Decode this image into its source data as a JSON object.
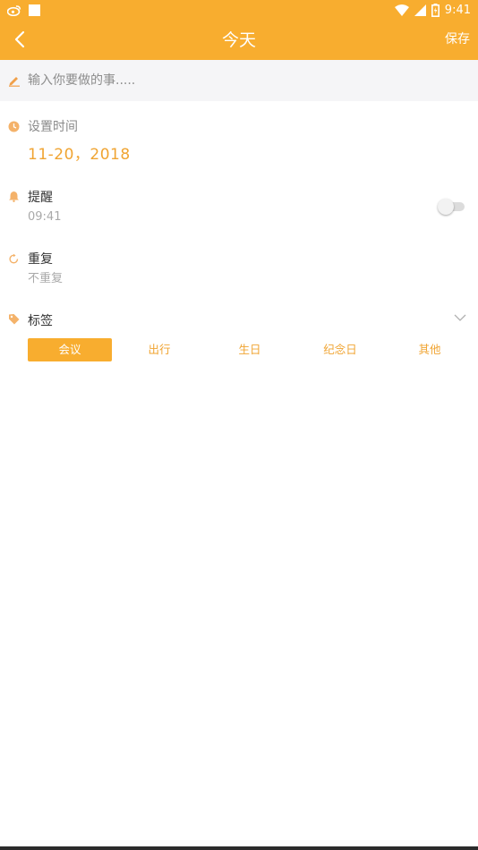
{
  "status_bar": {
    "time": "9:41",
    "icons": [
      "weibo-icon",
      "notification-square-icon",
      "wifi-icon",
      "cell-signal-icon",
      "battery-icon"
    ]
  },
  "app_bar": {
    "title": "今天",
    "save_label": "保存",
    "back_icon": "chevron-left-icon",
    "background": "#f8ad2f"
  },
  "task_input": {
    "placeholder": "输入你要做的事.....",
    "value": "",
    "icon": "pencil-icon"
  },
  "set_time": {
    "label": "设置时间",
    "value": "11-20，2018",
    "icon": "clock-icon"
  },
  "reminder": {
    "label": "提醒",
    "time": "09:41",
    "enabled": false,
    "icon": "bell-icon"
  },
  "repeat": {
    "label": "重复",
    "value": "不重复",
    "icon": "repeat-icon"
  },
  "tags": {
    "label": "标签",
    "icon": "tag-icon",
    "expand_icon": "chevron-down-icon",
    "items": [
      {
        "label": "会议",
        "selected": true
      },
      {
        "label": "出行",
        "selected": false
      },
      {
        "label": "生日",
        "selected": false
      },
      {
        "label": "纪念日",
        "selected": false
      },
      {
        "label": "其他",
        "selected": false
      }
    ]
  },
  "colors": {
    "accent": "#f8ad2f",
    "accent_text": "#f0a432",
    "icon_orange": "#f4b26a"
  }
}
